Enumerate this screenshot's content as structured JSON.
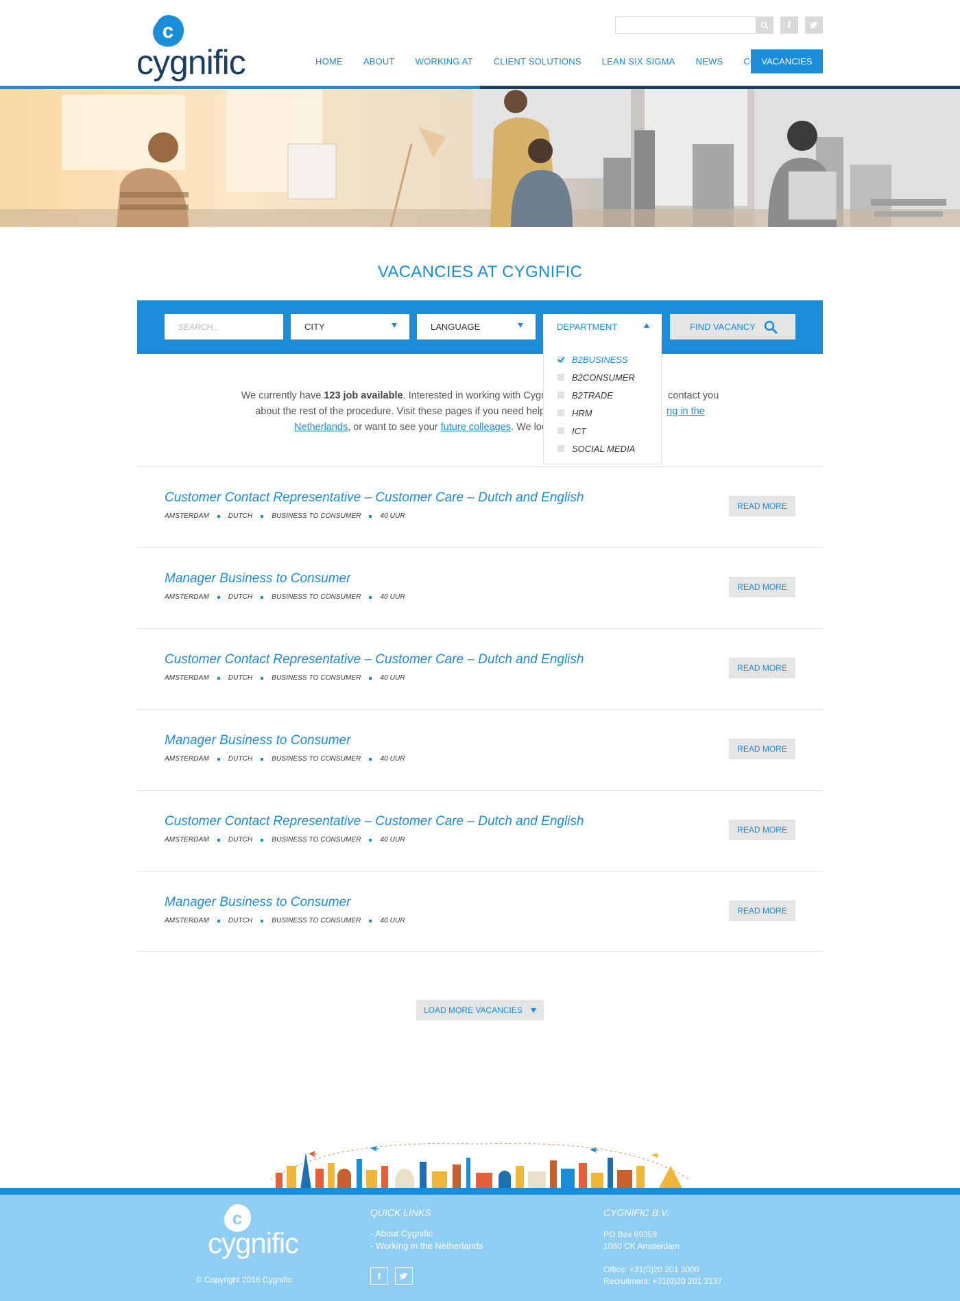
{
  "brand": {
    "name": "cygnific",
    "accent": "#1a8cd8",
    "navy": "#1d3c63",
    "footer_bg": "#8fcdf3"
  },
  "header": {
    "search_placeholder": "",
    "social": [
      "facebook-icon",
      "twitter-icon"
    ],
    "nav": [
      "HOME",
      "ABOUT",
      "WORKING AT",
      "CLIENT SOLUTIONS",
      "LEAN SIX SIGMA",
      "NEWS",
      "CONTACT"
    ],
    "nav_active": "VACANCIES"
  },
  "page_title": "VACANCIES AT CYGNIFIC",
  "filters": {
    "search_placeholder": "SEARCH...",
    "city": "CITY",
    "language": "LANGUAGE",
    "department": "DEPARTMENT",
    "find": "FIND VACANCY",
    "department_options": [
      {
        "label": "B2BUSINESS",
        "checked": true
      },
      {
        "label": "B2CONSUMER",
        "checked": false
      },
      {
        "label": "B2TRADE",
        "checked": false
      },
      {
        "label": "HRM",
        "checked": false
      },
      {
        "label": "ICT",
        "checked": false
      },
      {
        "label": "SOCIAL MEDIA",
        "checked": false
      }
    ]
  },
  "intro": {
    "part1": "We currently have ",
    "count": "123 job available",
    "part2": ". Interested in working with Cygn",
    "part3": " contact you",
    "part4": "about the rest of the procedure. Visit these pages if you need help ",
    "link1_a": "ng in the",
    "link1_b": "Netherlands",
    "part5": ", or want to see your ",
    "link2": "future colleages",
    "part6": ". We loo"
  },
  "jobs": [
    {
      "title": "Customer Contact Representative – Customer Care – Dutch and English",
      "meta": [
        "AMSTERDAM",
        "DUTCH",
        "BUSINESS TO CONSUMER",
        "40 UUR"
      ],
      "action": "READ MORE"
    },
    {
      "title": "Manager Business to Consumer",
      "meta": [
        "AMSTERDAM",
        "DUTCH",
        "BUSINESS TO CONSUMER",
        "40 UUR"
      ],
      "action": "READ MORE"
    },
    {
      "title": "Customer Contact Representative – Customer Care – Dutch and English",
      "meta": [
        "AMSTERDAM",
        "DUTCH",
        "BUSINESS TO CONSUMER",
        "40 UUR"
      ],
      "action": "READ MORE"
    },
    {
      "title": "Manager Business to Consumer",
      "meta": [
        "AMSTERDAM",
        "DUTCH",
        "BUSINESS TO CONSUMER",
        "40 UUR"
      ],
      "action": "READ MORE"
    },
    {
      "title": "Customer Contact Representative – Customer Care – Dutch and English",
      "meta": [
        "AMSTERDAM",
        "DUTCH",
        "BUSINESS TO CONSUMER",
        "40 UUR"
      ],
      "action": "READ MORE"
    },
    {
      "title": "Manager Business to Consumer",
      "meta": [
        "AMSTERDAM",
        "DUTCH",
        "BUSINESS TO CONSUMER",
        "40 UUR"
      ],
      "action": "READ MORE"
    }
  ],
  "load_more": "LOAD MORE VACANCIES",
  "footer": {
    "copyright": "© Copyright 2016 Cygnific",
    "quick_links_heading": "QUICK LINKS",
    "quick_links": [
      "- About Cygnific",
      "- Working in the Netherlands"
    ],
    "company_heading": "CYGNIFIC B.V.",
    "address": [
      "PO Box 69359",
      "1060 CK Amsterdam"
    ],
    "phones": [
      "Office: +31(0)20 201 3000",
      "Recruitment: +31(0)20 201 3137"
    ]
  }
}
